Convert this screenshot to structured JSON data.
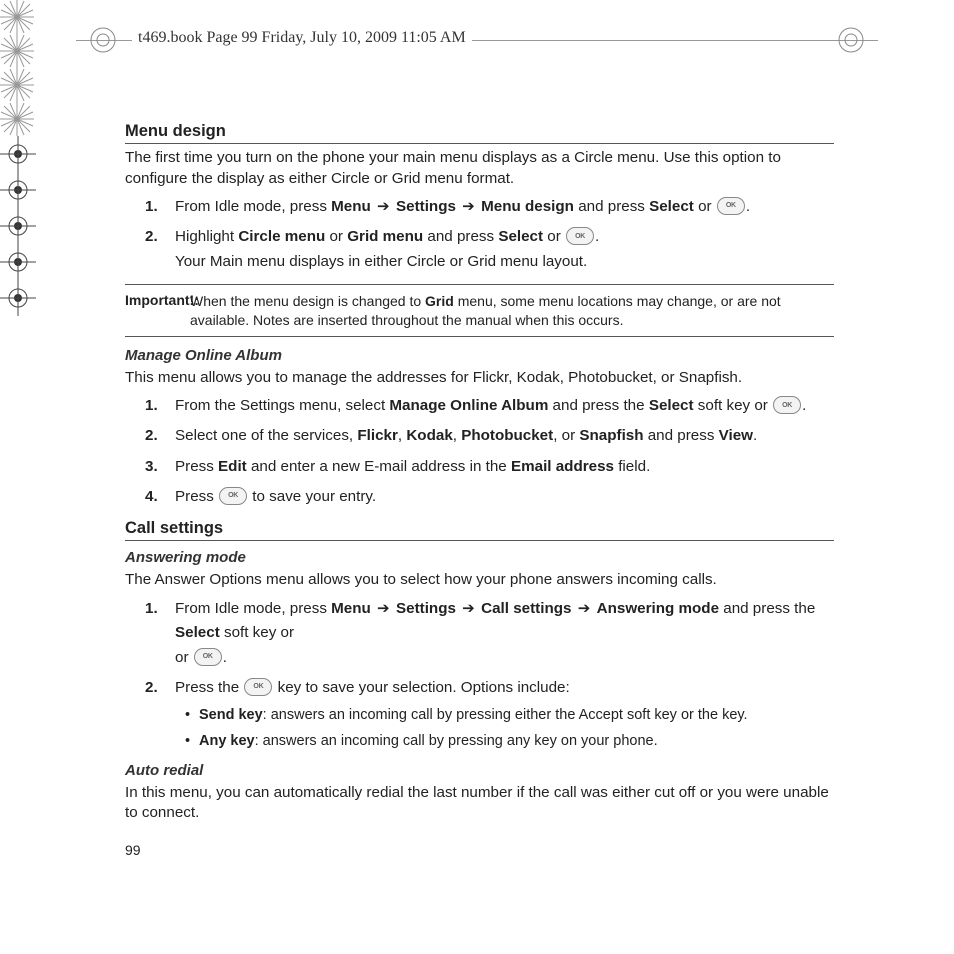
{
  "header": "t469.book  Page 99  Friday, July 10, 2009  11:05 AM",
  "sections": {
    "menuDesign": {
      "title": "Menu design",
      "intro": "The first time you turn on the phone your main menu displays as a Circle menu. Use this option to configure the display as either Circle or Grid menu format.",
      "step1_a": "From Idle mode, press ",
      "step1_menu": "Menu",
      "step1_settings": "Settings",
      "step1_md": "Menu design",
      "step1_b": " and press ",
      "step1_select": "Select",
      "step1_or": " or ",
      "step2_a": "Highlight ",
      "step2_cm": "Circle menu",
      "step2_or1": " or ",
      "step2_gm": "Grid menu",
      "step2_b": " and press ",
      "step2_select": "Select",
      "step2_or2": " or ",
      "step2_note": "Your Main menu displays in either Circle or Grid menu layout.",
      "important_label": "Important!:",
      "important_a": "When the menu design is changed to ",
      "important_grid": "Grid",
      "important_b": " menu, some menu locations may change, or are not available. Notes are inserted throughout the manual when this occurs."
    },
    "manageAlbum": {
      "title": "Manage Online Album",
      "intro": "This menu allows you to manage the addresses for Flickr, Kodak, Photobucket, or Snapfish.",
      "s1_a": "From the Settings menu, select ",
      "s1_moa": "Manage Online Album",
      "s1_b": "  and press the ",
      "s1_select": "Select",
      "s1_c": " soft key or ",
      "s2_a": "Select one of the services, ",
      "s2_flickr": "Flickr",
      "s2_c1": ", ",
      "s2_kodak": "Kodak",
      "s2_c2": ", ",
      "s2_pb": "Photobucket",
      "s2_c3": ", or ",
      "s2_sf": "Snapfish",
      "s2_d": " and press ",
      "s2_view": "View",
      "s3_a": "Press ",
      "s3_edit": "Edit",
      "s3_b": " and enter a new E-mail address in the ",
      "s3_ea": "Email address",
      "s3_c": " field.",
      "s4_a": "Press ",
      "s4_b": " to save your entry."
    },
    "callSettings": {
      "title": "Call settings",
      "answering": {
        "title": "Answering mode",
        "intro": "The Answer Options menu allows you to select how your phone answers incoming calls.",
        "s1_a": "From Idle mode, press ",
        "s1_menu": "Menu",
        "s1_settings": "Settings",
        "s1_cs": "Call settings",
        "s1_am": "Answering mode",
        "s1_b": " and press the ",
        "s1_select": "Select",
        "s1_c": " soft key or ",
        "s2_a": "Press the ",
        "s2_b": " key to save your selection. Options include:",
        "b1_k": "Send key",
        "b1_t": ": answers an incoming call by pressing either the Accept soft key or the key.",
        "b2_k": "Any key",
        "b2_t": ": answers an incoming call by pressing any key on your phone."
      },
      "autoRedial": {
        "title": "Auto redial",
        "text": "In this menu, you can automatically redial the last number if the call was either cut off or you were unable to connect."
      }
    }
  },
  "pageNumber": "99",
  "ok": "OK",
  "arrow": "➔"
}
